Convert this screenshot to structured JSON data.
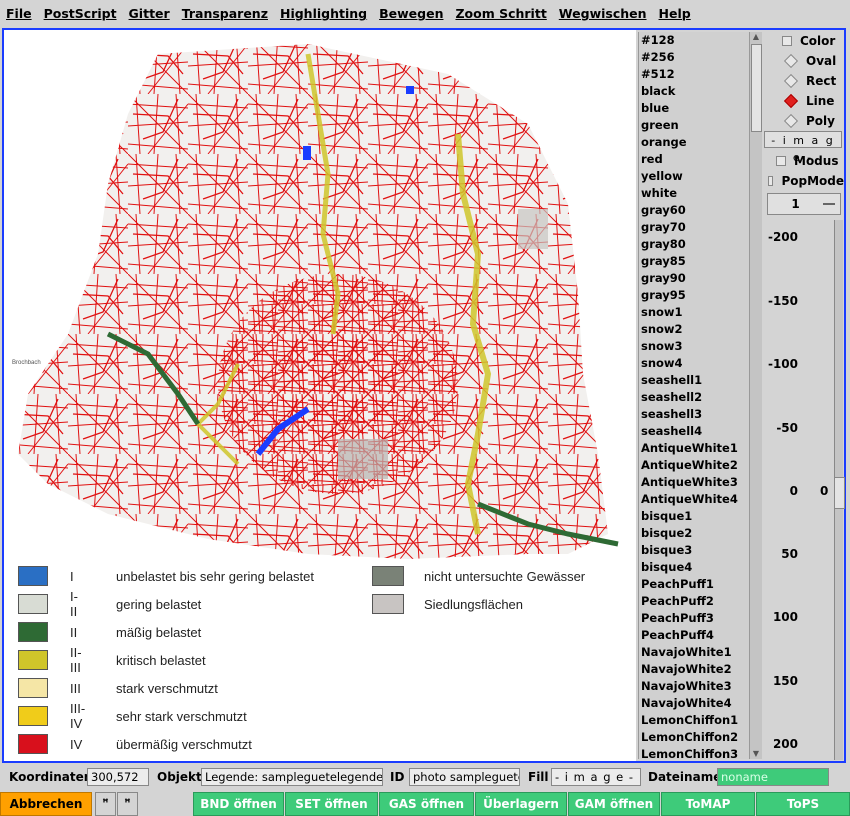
{
  "menu": [
    "File",
    "PostScript",
    "Gitter",
    "Transparenz",
    "Highlighting",
    "Bewegen",
    "Zoom Schritt",
    "Wegwischen",
    "Help"
  ],
  "colors": [
    "#128",
    "#256",
    "#512",
    "black",
    "blue",
    "green",
    "orange",
    "red",
    "yellow",
    "white",
    "gray60",
    "gray70",
    "gray80",
    "gray85",
    "gray90",
    "gray95",
    "snow1",
    "snow2",
    "snow3",
    "snow4",
    "seashell1",
    "seashell2",
    "seashell3",
    "seashell4",
    "AntiqueWhite1",
    "AntiqueWhite2",
    "AntiqueWhite3",
    "AntiqueWhite4",
    "bisque1",
    "bisque2",
    "bisque3",
    "bisque4",
    "PeachPuff1",
    "PeachPuff2",
    "PeachPuff3",
    "PeachPuff4",
    "NavajoWhite1",
    "NavajoWhite2",
    "NavajoWhite3",
    "NavajoWhite4",
    "LemonChiffon1",
    "LemonChiffon2",
    "LemonChiffon3"
  ],
  "shapes": {
    "color": "Color",
    "oval": "Oval",
    "rect": "Rect",
    "line": "Line",
    "poly": "Poly",
    "selected": "Line"
  },
  "image_label": "- i m a g e -",
  "modus": "Modus",
  "popmode": "PopMode",
  "dropdown_value": "1",
  "scale_ticks": [
    "-200",
    "-150",
    "-100",
    "-50",
    "0",
    "50",
    "100",
    "150",
    "200"
  ],
  "scale_value": "0",
  "legend_left": [
    {
      "class": "I",
      "text": "unbelastet bis sehr gering belastet",
      "color": "#2a6fc4"
    },
    {
      "class": "I-II",
      "text": "gering belastet",
      "color": "#d8dcd4"
    },
    {
      "class": "II",
      "text": "mäßig belastet",
      "color": "#2e6a34"
    },
    {
      "class": "II-III",
      "text": "kritisch belastet",
      "color": "#cfc52a"
    },
    {
      "class": "III",
      "text": "stark verschmutzt",
      "color": "#f5e6a6"
    },
    {
      "class": "III-IV",
      "text": "sehr stark verschmutzt",
      "color": "#f0cc1a"
    },
    {
      "class": "IV",
      "text": "übermäßig verschmutzt",
      "color": "#d8101c"
    }
  ],
  "legend_right": [
    {
      "text": "nicht untersuchte Gewässer",
      "color": "#7a8277"
    },
    {
      "text": "Siedlungsflächen",
      "color": "#c8c4c2"
    }
  ],
  "map_labels": [
    "Brochbach"
  ],
  "status": {
    "koordinaten_label": "Koordinaten",
    "koordinaten": "300,572",
    "objekt_label": "Objekt",
    "objekt": "Legende: sampleguetelegende",
    "id_label": "ID",
    "id": "photo sampleguetel",
    "fill_label": "Fill",
    "fill": "- i m a g e -",
    "dateiname_label": "Dateiname",
    "dateiname": "noname"
  },
  "buttons": {
    "abbrechen": "Abbrechen",
    "small1": "ꟸ",
    "small2": "ꟸ",
    "bnd": "BND öffnen",
    "set": "SET öffnen",
    "gas": "GAS öffnen",
    "ueberlagern": "Überlagern",
    "gam": "GAM öffnen",
    "tomap": "ToMAP",
    "tops": "ToPS"
  },
  "palette": {
    "accent": "#1a3cff",
    "button_green": "#3ecb7a",
    "button_orange": "#ffa000",
    "road_red": "#e01010"
  }
}
